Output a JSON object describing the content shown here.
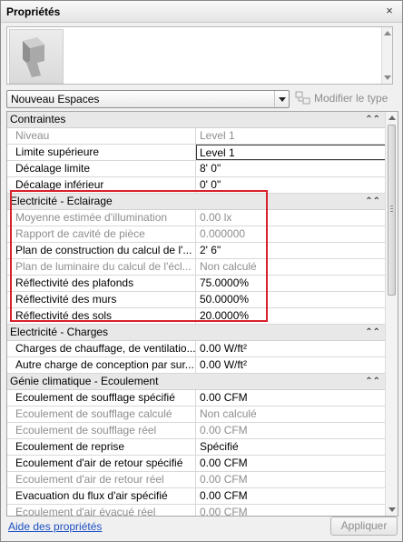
{
  "window": {
    "title": "Propriétés",
    "close_glyph": "×"
  },
  "preview": {
    "icon": "3d-family-preview-icon"
  },
  "type_selector": {
    "value": "Nouveau Espaces"
  },
  "edit_type": {
    "label": "Modifier le type",
    "icon": "edit-type-icon"
  },
  "sections": [
    {
      "title": "Contraintes",
      "rows": [
        {
          "name": "Niveau",
          "value": "Level 1",
          "disabled": true
        },
        {
          "name": "Limite supérieure",
          "value": "Level 1",
          "editing": true
        },
        {
          "name": "Décalage limite",
          "value": "8'  0\""
        },
        {
          "name": "Décalage inférieur",
          "value": "0'  0\""
        }
      ]
    },
    {
      "title": "Electricité - Eclairage",
      "rows": [
        {
          "name": "Moyenne estimée d'illumination",
          "value": "0.00 lx",
          "disabled": true
        },
        {
          "name": "Rapport de cavité de pièce",
          "value": "0.000000",
          "disabled": true
        },
        {
          "name": "Plan de construction du calcul de l'...",
          "value": "2'  6\""
        },
        {
          "name": "Plan de luminaire du calcul de l'écl...",
          "value": "Non calculé",
          "disabled": true
        },
        {
          "name": "Réflectivité des plafonds",
          "value": "75.0000%"
        },
        {
          "name": "Réflectivité des murs",
          "value": "50.0000%"
        },
        {
          "name": "Réflectivité des sols",
          "value": "20.0000%"
        }
      ]
    },
    {
      "title": "Electricité - Charges",
      "rows": [
        {
          "name": "Charges de chauffage, de ventilatio...",
          "value": "0.00 W/ft²"
        },
        {
          "name": "Autre charge de conception par sur...",
          "value": "0.00 W/ft²"
        }
      ]
    },
    {
      "title": "Génie climatique - Ecoulement",
      "rows": [
        {
          "name": "Ecoulement de soufflage spécifié",
          "value": "0.00 CFM"
        },
        {
          "name": "Ecoulement de soufflage calculé",
          "value": "Non calculé",
          "disabled": true
        },
        {
          "name": "Ecoulement de soufflage réel",
          "value": "0.00 CFM",
          "disabled": true
        },
        {
          "name": "Ecoulement de reprise",
          "value": "Spécifié"
        },
        {
          "name": "Ecoulement d'air de retour spécifié",
          "value": "0.00 CFM"
        },
        {
          "name": "Ecoulement d'air de retour réel",
          "value": "0.00 CFM",
          "disabled": true
        },
        {
          "name": "Evacuation du flux d'air spécifié",
          "value": "0.00 CFM"
        },
        {
          "name": "Ecoulement d'air évacué réel",
          "value": "0.00 CFM",
          "disabled": true
        }
      ]
    }
  ],
  "collapse_glyph": "⌃⌃",
  "footer": {
    "help_link": "Aide des propriétés",
    "apply_label": "Appliquer"
  },
  "colors": {
    "highlight": "#d9202a",
    "link": "#1b4fc4",
    "disabled_text": "#8e8e8e",
    "section_bg": "#e8e8e8"
  }
}
